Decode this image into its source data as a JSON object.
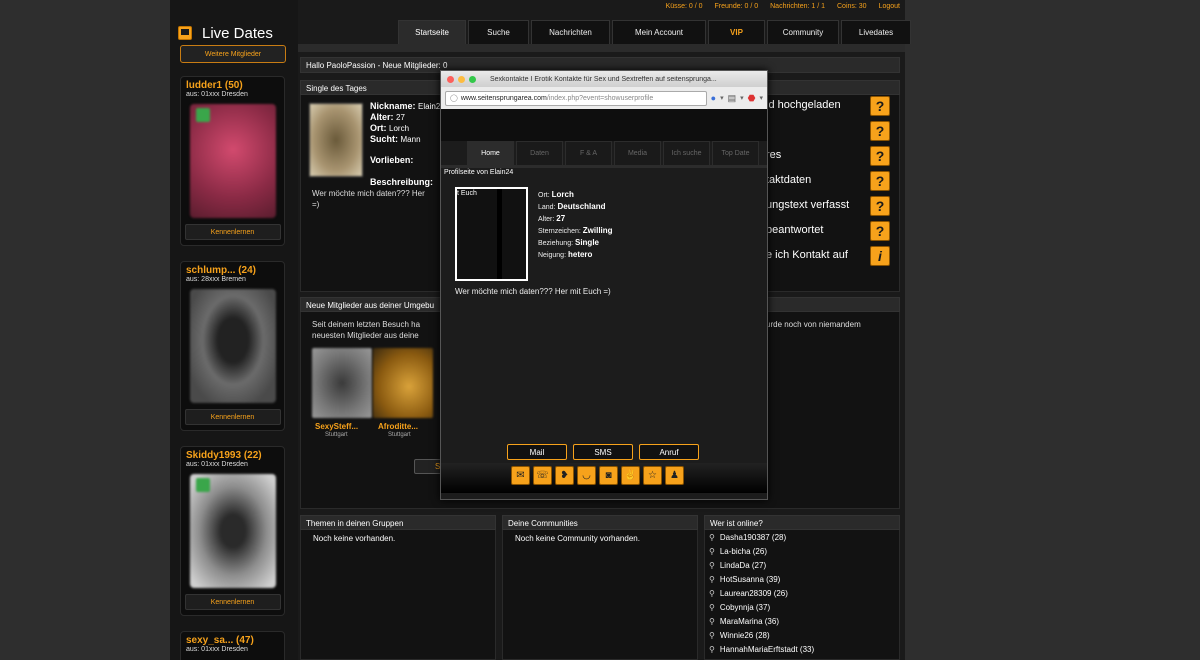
{
  "brand": {
    "title": "Live Dates",
    "more_label": "Weitere Mitglieder"
  },
  "topbar": {
    "items": [
      "Küsse: 0 / 0",
      "Freunde: 0 / 0",
      "Nachrichten: 1 / 1",
      "Coins: 30",
      "Logout"
    ]
  },
  "tabs": [
    "Startseite",
    "Suche",
    "Nachrichten",
    "Mein Account",
    "VIP",
    "Community",
    "Livedates"
  ],
  "greeting": "Hallo PaoloPassion  - Neue Mitglieder: 0",
  "members": [
    {
      "name": "ludder1 (50)",
      "from": "aus: 01xxx Dresden",
      "button": "Kennenlernen"
    },
    {
      "name": "schlump... (24)",
      "from": "aus: 28xxx Bremen",
      "button": "Kennenlernen"
    },
    {
      "name": "Skiddy1993 (22)",
      "from": "aus: 01xxx Dresden",
      "button": "Kennenlernen"
    },
    {
      "name": "sexy_sa... (47)",
      "from": "aus: 01xxx Dresden"
    }
  ],
  "single": {
    "title": "Single des Tages",
    "nickname_label": "Nickname:",
    "nickname": "Elain24",
    "alter_label": "Alter:",
    "alter": "27",
    "ort_label": "Ort:",
    "ort": "Lorch",
    "sucht_label": "Sucht:",
    "sucht": "Mann",
    "vorlieben_label": "Vorlieben:",
    "beschreibung_label": "Beschreibung:",
    "beschreibung_1": "Wer möchte mich daten??? Her",
    "beschreibung_2": "=)"
  },
  "right_list": [
    {
      "text": "ld hochgeladen",
      "icon": "?"
    },
    {
      "text": "",
      "icon": "?"
    },
    {
      "text": "res",
      "icon": "?"
    },
    {
      "text": "taktdaten",
      "icon": "?"
    },
    {
      "text": "ungstext verfasst",
      "icon": "?"
    },
    {
      "text": "beantwortet",
      "icon": "?"
    },
    {
      "text": "e ich Kontakt auf",
      "icon": "i"
    }
  ],
  "neue": {
    "title": "Neue Mitglieder aus deiner Umgebu",
    "line1": "Seit deinem letzten Besuch ha",
    "line2": "neuesten Mitglieder aus deine",
    "right_text": "urde noch von niemandem",
    "thumbs": [
      {
        "name": "SexySteff...",
        "city": "Stuttgart"
      },
      {
        "name": "Afroditte...",
        "city": "Stuttgart"
      }
    ],
    "btn_fragment": "S"
  },
  "popup": {
    "title": "Sexkontakte I Erotik Kontakte für Sex und Sextreffen auf seitensprunga...",
    "url_host": "www.seitensprungarea.com",
    "url_path": "/index.php?event=showuserprofile",
    "tabs": [
      "Home",
      "Daten",
      "F & A",
      "Media",
      "Ich suche",
      "Top Date"
    ],
    "heading": "Profilseite von Elain24",
    "photo_caption": "t Euch",
    "fields": [
      {
        "label": "Ort:",
        "value": "Lorch"
      },
      {
        "label": "Land:",
        "value": "Deutschland"
      },
      {
        "label": "Alter:",
        "value": "27"
      },
      {
        "label": "Sternzeichen:",
        "value": "Zwilling"
      },
      {
        "label": "Beziehung:",
        "value": "Single"
      },
      {
        "label": "Neigung:",
        "value": "hetero"
      }
    ],
    "bio": "Wer möchte mich daten??? Her mit Euch =)",
    "mail": "Mail",
    "sms": "SMS",
    "anruf": "Anruf"
  },
  "gruppen": {
    "title": "Themen in deinen Gruppen",
    "empty": "Noch keine vorhanden."
  },
  "communities": {
    "title": "Deine Communities",
    "empty": "Noch keine Community vorhanden."
  },
  "online": {
    "title": "Wer ist online?",
    "users": [
      "Dasha190387 (28)",
      "La-bicha (26)",
      "LindaDa (27)",
      "HotSusanna (39)",
      "Laurean28309 (26)",
      "Cobynnja (37)",
      "MaraMarina (36)",
      "Winnie26 (28)",
      "HannahMariaErftstadt (33)"
    ]
  }
}
